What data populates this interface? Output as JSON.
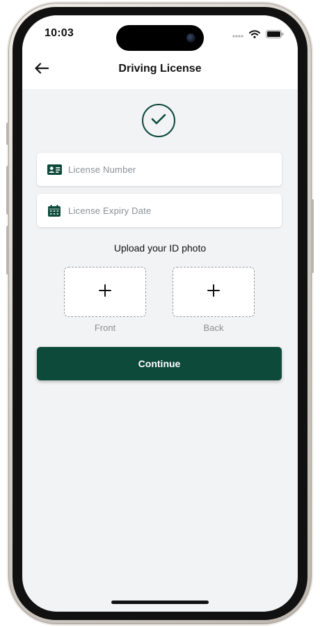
{
  "status_bar": {
    "time": "10:03"
  },
  "header": {
    "title": "Driving License",
    "back_icon": "arrow-left-icon"
  },
  "status_check": {
    "icon": "check-icon",
    "color": "#0e4a3a"
  },
  "form": {
    "license_number": {
      "placeholder": "License Number",
      "icon": "id-card-icon"
    },
    "license_expiry": {
      "placeholder": "License Expiry Date",
      "icon": "calendar-icon"
    }
  },
  "upload": {
    "heading": "Upload your ID photo",
    "front_label": "Front",
    "back_label": "Back",
    "add_icon": "plus-icon"
  },
  "actions": {
    "continue_label": "Continue"
  },
  "colors": {
    "accent": "#0e4a3a",
    "background": "#f2f3f5",
    "placeholder_text": "#8c8f93"
  }
}
